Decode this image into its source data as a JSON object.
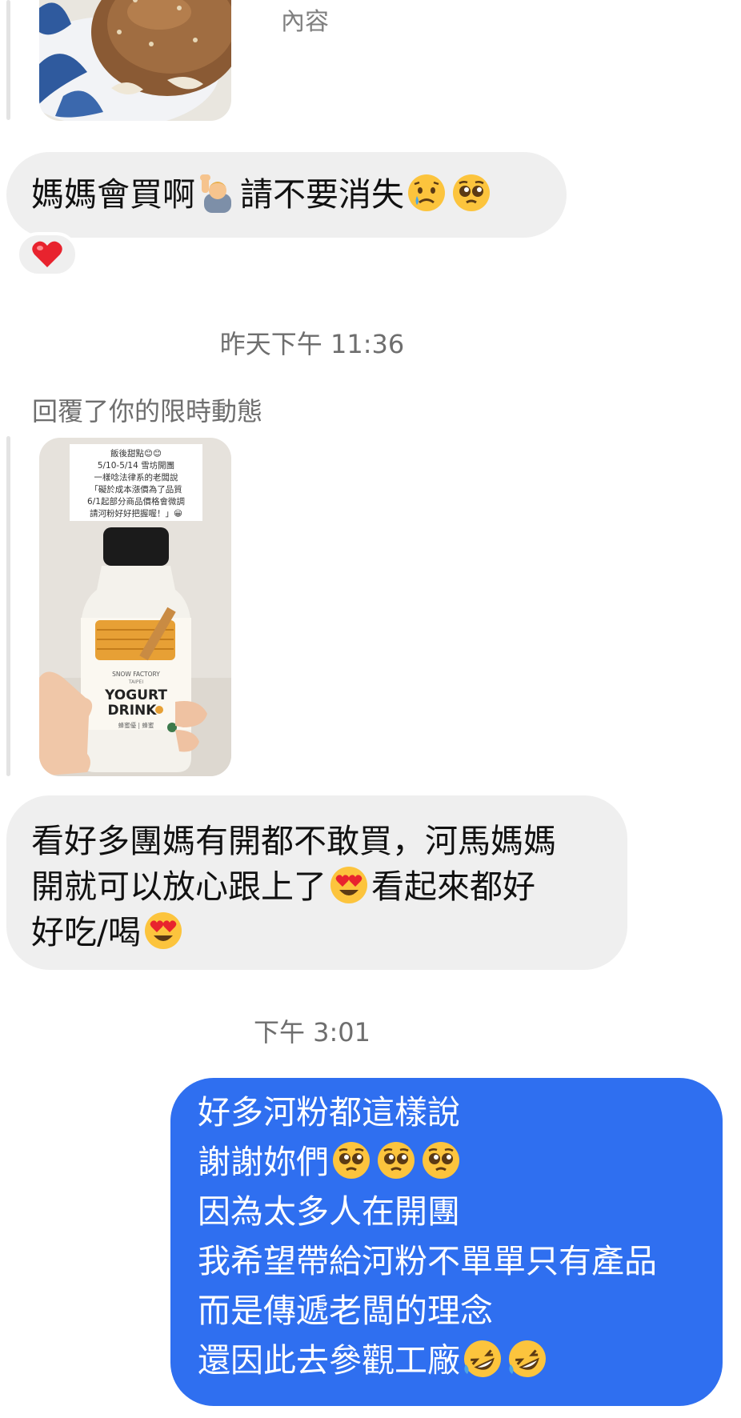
{
  "chat": {
    "top_story_caption": "內容",
    "reaction_emoji": "heart",
    "timestamps": [
      "昨天下午 11:36",
      "下午 3:01"
    ],
    "story_reply_label": "回覆了你的限時動態",
    "story": {
      "note_lines": [
        "飯後甜點😊😊",
        "5/10-5/14 雪坊開團",
        "一樣唸法律系的老闆說",
        "「礙於成本漲價為了品質",
        "6/1起部分商品價格會微調",
        "請河粉好好把握喔！」😀"
      ],
      "bottle_brand": "SNOW FACTORY",
      "bottle_brand_sub": "TAIPEI",
      "bottle_line1": "YOGURT",
      "bottle_line2": "DRINK",
      "bottle_sub": "蜂蜜優 | 蜂蜜"
    },
    "messages": {
      "msg1": {
        "a": "媽媽會買啊",
        "b": "請不要消失"
      },
      "msg2": {
        "l1": "看好多團媽有開都不敢買，河馬媽媽",
        "l2a": "開就可以放心跟上了",
        "l2b": "看起來都好",
        "l3": "好吃/喝"
      },
      "msg3": {
        "l1": "好多河粉都這樣說",
        "l2": "謝謝妳們",
        "l3": "因為太多人在開團",
        "l4": "我希望帶給河粉不單單只有產品",
        "l5": "而是傳遞老闆的理念",
        "l6": "還因此去參觀工廠"
      }
    }
  },
  "colors": {
    "incoming_bubble": "#efefef",
    "outgoing_bubble": "#2f6ff0",
    "outgoing_text": "#ffffff",
    "timestamp_text": "#6e6e6e"
  }
}
